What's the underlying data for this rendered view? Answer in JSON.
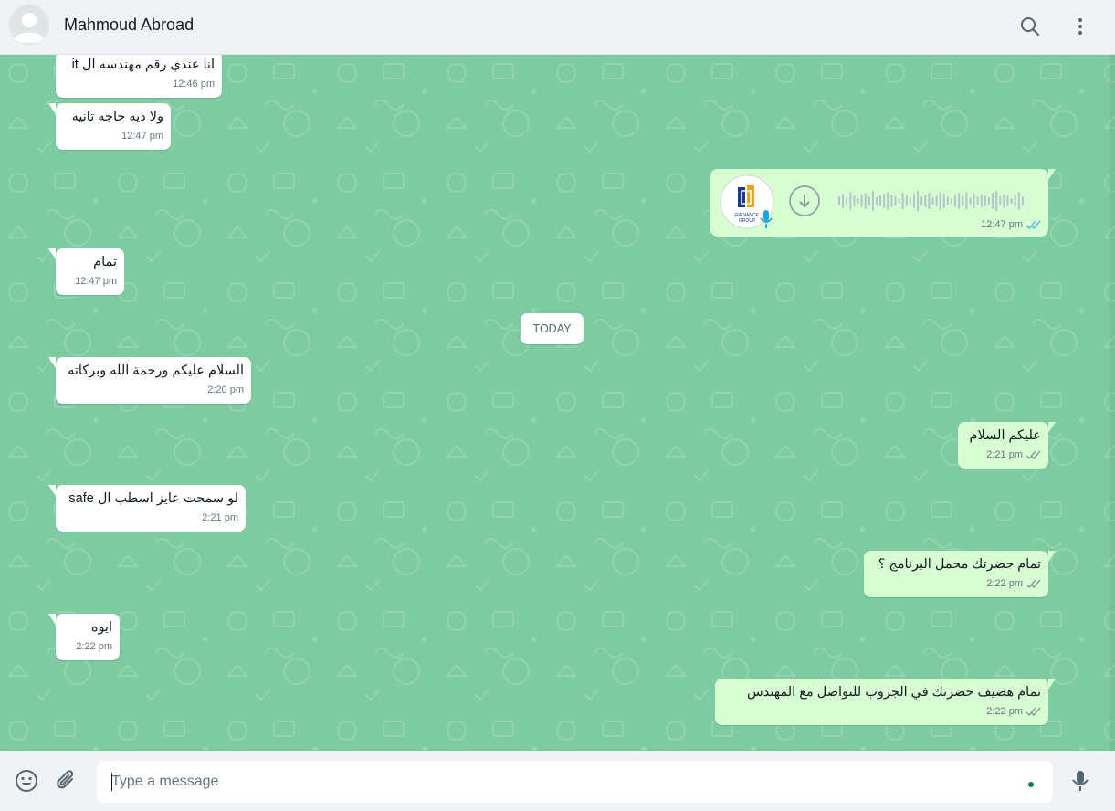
{
  "header": {
    "contact_name": "Mahmoud Abroad",
    "avatar_icon": "default-avatar-icon",
    "search_icon": "search-icon",
    "menu_icon": "more-vertical-icon"
  },
  "chat": {
    "wallpaper_color": "#7ecba1",
    "date_separator": "TODAY",
    "messages": [
      {
        "dir": "in",
        "text": "انا عندي رقم مهندسه ال it",
        "time": "12:46 pm"
      },
      {
        "dir": "in",
        "text": "ولا ديه حاجه تانيه",
        "time": "12:47 pm"
      },
      {
        "dir": "out",
        "type": "voice",
        "logo_text": "RADIANCE GROUP",
        "time": "12:47 pm",
        "status": "read"
      },
      {
        "dir": "in",
        "text": "تمام",
        "time": "12:47 pm"
      },
      {
        "dir": "in",
        "text": "السلام عليكم ورحمة الله وبركاته",
        "time": "2:20 pm"
      },
      {
        "dir": "out",
        "text": "عليكم السلام",
        "time": "2:21 pm",
        "status": "delivered"
      },
      {
        "dir": "in",
        "text": "لو سمحت عايز اسطب ال safe",
        "time": "2:21 pm"
      },
      {
        "dir": "out",
        "text": "تمام حضرتك محمل البرنامج ؟",
        "time": "2:22 pm",
        "status": "delivered"
      },
      {
        "dir": "in",
        "text": "ايوه",
        "time": "2:22 pm"
      },
      {
        "dir": "out",
        "text": "تمام هضيف حضرتك في الجروب للتواصل مع المهندس",
        "time": "2:22 pm",
        "status": "delivered"
      }
    ]
  },
  "footer": {
    "emoji_icon": "emoji-icon",
    "attach_icon": "paperclip-icon",
    "input_placeholder": "Type a message",
    "input_value": "",
    "mic_icon": "microphone-icon"
  },
  "colors": {
    "incoming_bubble": "#ffffff",
    "outgoing_bubble": "#d9fdd3",
    "read_ticks": "#53bdeb",
    "delivered_ticks": "#8696a0"
  }
}
